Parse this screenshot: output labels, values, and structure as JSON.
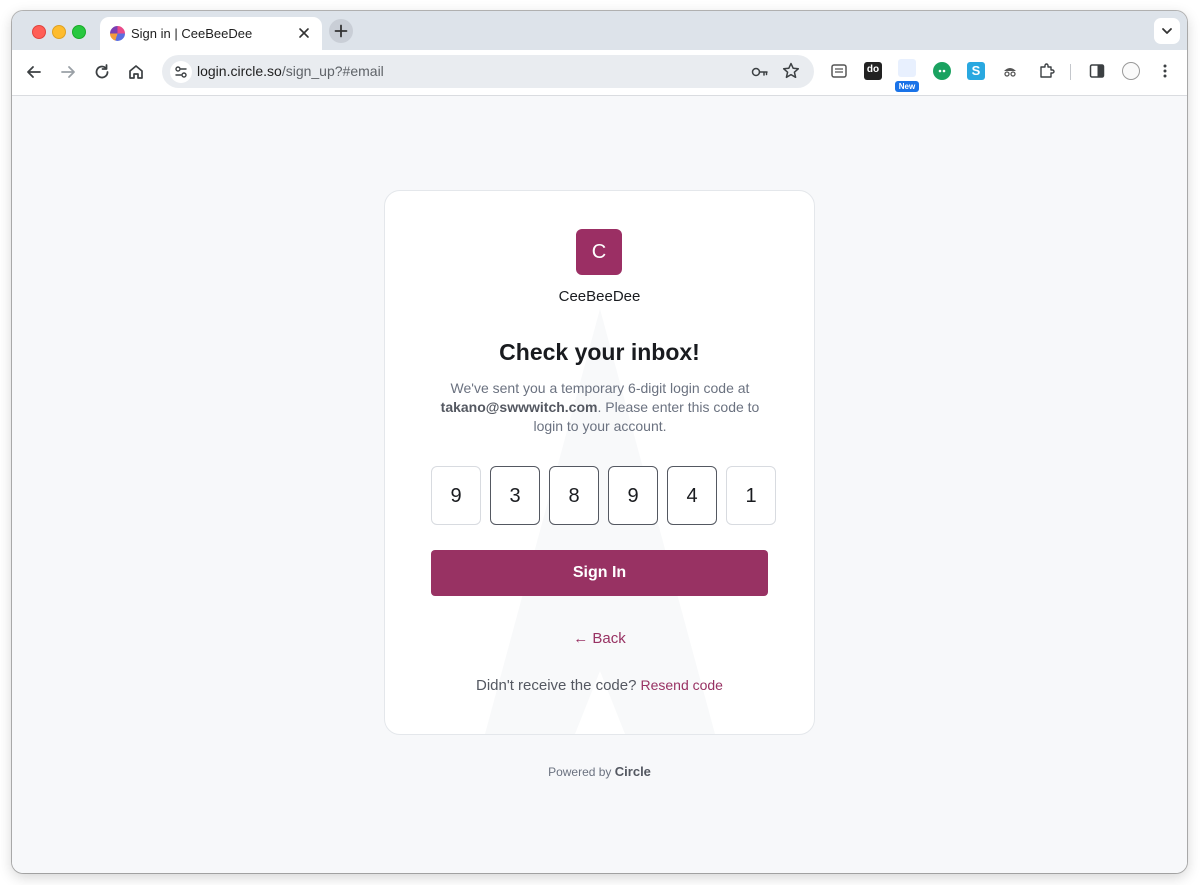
{
  "browser": {
    "tab_title": "Sign in | CeeBeeDee",
    "url_host": "login.circle.so",
    "url_path": "/sign_up?#email",
    "new_badge": "New"
  },
  "page": {
    "community_initial": "C",
    "community_name": "CeeBeeDee",
    "heading": "Check your inbox!",
    "description_prefix": "We've sent you a temporary 6-digit login code at",
    "email": "takano@swwwitch.com",
    "description_suffix": ". Please enter this code to login to your account.",
    "code_digits": [
      "9",
      "3",
      "8",
      "9",
      "4",
      "1"
    ],
    "signin_label": "Sign In",
    "back_label": "← Back",
    "resend_prompt": "Didn't receive the code?",
    "resend_label": "Resend code",
    "powered_prefix": "Powered by",
    "powered_brand": "Circle"
  },
  "colors": {
    "accent": "#983263",
    "logo_bg": "#9b2f64"
  }
}
